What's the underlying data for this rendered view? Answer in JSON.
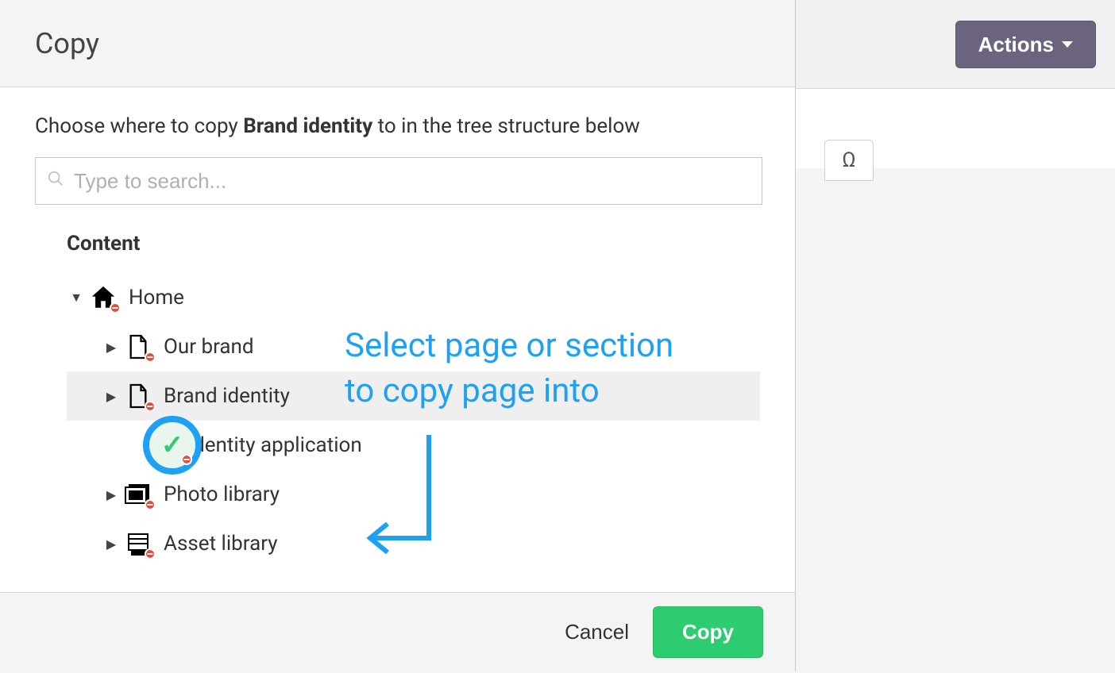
{
  "background": {
    "actions_label": "Actions",
    "omega_symbol": "Ω"
  },
  "modal": {
    "title": "Copy",
    "prompt_prefix": "Choose where to copy ",
    "prompt_bold": "Brand identity",
    "prompt_suffix": " to in the tree structure below",
    "search_placeholder": "Type to search...",
    "tree_header": "Content",
    "tree": {
      "root_label": "Home",
      "items": [
        {
          "label": "Our brand",
          "selected": false,
          "highlight": false,
          "icon": "page"
        },
        {
          "label": "Brand identity",
          "selected": false,
          "highlight": true,
          "icon": "page"
        },
        {
          "label": "Identity application",
          "selected": true,
          "highlight": false,
          "icon": "check"
        },
        {
          "label": "Photo library",
          "selected": false,
          "highlight": false,
          "icon": "photo"
        },
        {
          "label": "Asset library",
          "selected": false,
          "highlight": false,
          "icon": "asset"
        }
      ]
    },
    "annotation_line1": "Select page or section",
    "annotation_line2": "to copy page into",
    "cancel_label": "Cancel",
    "copy_label": "Copy"
  }
}
